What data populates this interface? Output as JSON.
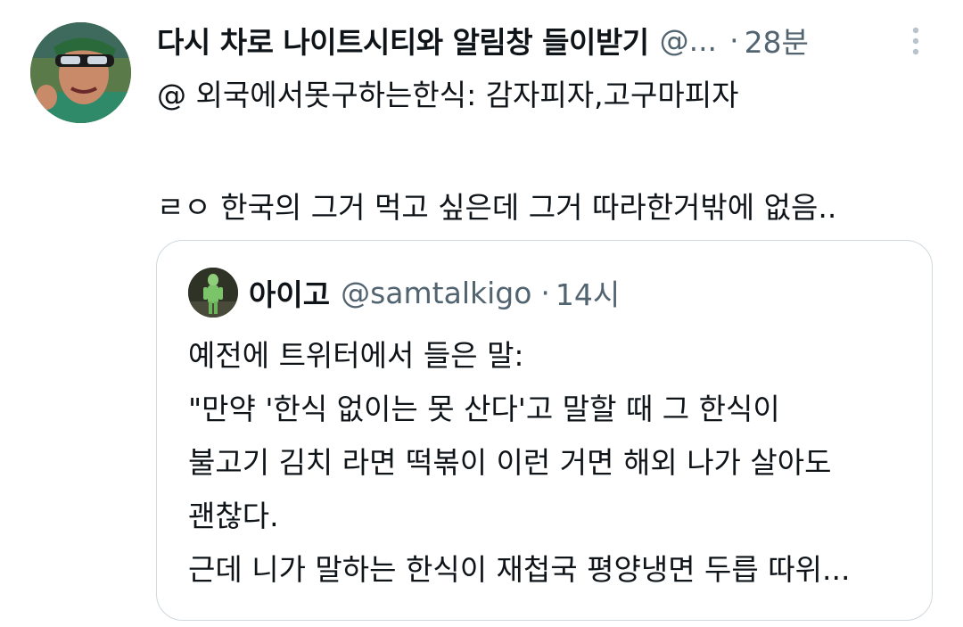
{
  "tweet": {
    "display_name": "다시 차로 나이트시티와 알림창 들이받기",
    "handle": "@...",
    "separator": "·",
    "time": "28분",
    "more_icon": "more-vertical-icon",
    "lines": [
      "@ 외국에서못구하는한식: 감자피자,고구마피자",
      "ㄹㅇ 한국의 그거 먹고 싶은데 그거 따라한거밖에 없음.."
    ]
  },
  "quote": {
    "display_name": "아이고",
    "handle": "@samtalkigo",
    "separator": "·",
    "time": "14시",
    "lines": [
      "예전에 트위터에서 들은 말:",
      "\"만약 '한식 없이는 못 산다'고 말할 때 그 한식이",
      "불고기 김치 라면 떡볶이 이런 거면 해외 나가 살아도",
      "괜찮다.",
      "근데 니가 말하는 한식이 재첩국 평양냉면 두릅 따위..."
    ]
  },
  "colors": {
    "text_primary": "#0f1419",
    "text_secondary": "#536471",
    "border": "#cfd9de",
    "background": "#ffffff"
  }
}
